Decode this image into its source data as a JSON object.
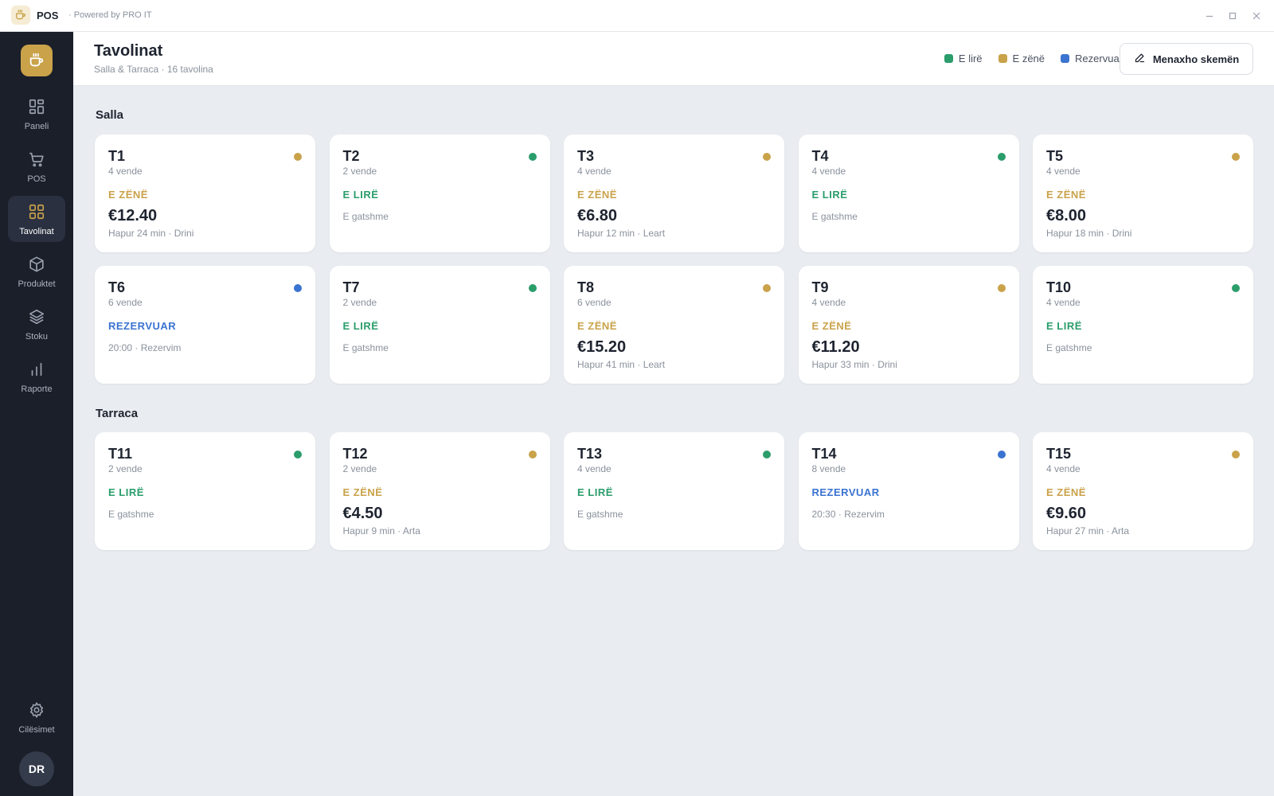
{
  "window": {
    "app_name": "POS",
    "powered_by": "· Powered by PRO IT"
  },
  "colors": {
    "accent": "#c9a24a",
    "free": "#2a9d6b",
    "occupied": "#c9a24a",
    "reserved": "#3b73d1",
    "sidebar_bg": "#1b1f2a",
    "page_bg": "#e9ecf0"
  },
  "sidebar": {
    "logo_icon": "coffee-cup-icon",
    "items": [
      {
        "label": "Paneli",
        "icon": "dashboard-icon",
        "active": false
      },
      {
        "label": "POS",
        "icon": "cart-icon",
        "active": false
      },
      {
        "label": "Tavolinat",
        "icon": "grid-icon",
        "active": true
      },
      {
        "label": "Produktet",
        "icon": "box-icon",
        "active": false
      },
      {
        "label": "Stoku",
        "icon": "layers-icon",
        "active": false
      },
      {
        "label": "Raporte",
        "icon": "bar-chart-icon",
        "active": false
      }
    ],
    "settings_label": "Cilësimet",
    "avatar_initials": "DR"
  },
  "header": {
    "title": "Tavolinat",
    "subtitle": "Salla & Tarraca · 16 tavolina",
    "legend": [
      {
        "label": "E lirë",
        "color": "#2a9d6b"
      },
      {
        "label": "E zënë",
        "color": "#c9a24a"
      },
      {
        "label": "Rezervuar",
        "color": "#3b73d1"
      }
    ],
    "edit_button_label": "Menaxho skemën"
  },
  "sections": [
    {
      "title": "Salla",
      "tables": [
        {
          "name": "T1",
          "seats": "4 vende",
          "status": "occupied",
          "status_label": "E ZËNË",
          "amount": "€12.40",
          "detail": "Hapur 24 min · Drini"
        },
        {
          "name": "T2",
          "seats": "2 vende",
          "status": "free",
          "status_label": "E LIRË",
          "amount": "",
          "detail": "E gatshme"
        },
        {
          "name": "T3",
          "seats": "4 vende",
          "status": "occupied",
          "status_label": "E ZËNË",
          "amount": "€6.80",
          "detail": "Hapur 12 min · Leart"
        },
        {
          "name": "T4",
          "seats": "4 vende",
          "status": "free",
          "status_label": "E LIRË",
          "amount": "",
          "detail": "E gatshme"
        },
        {
          "name": "T5",
          "seats": "4 vende",
          "status": "occupied",
          "status_label": "E ZËNË",
          "amount": "€8.00",
          "detail": "Hapur 18 min · Drini"
        },
        {
          "name": "T6",
          "seats": "6 vende",
          "status": "reserved",
          "status_label": "REZERVUAR",
          "amount": "",
          "detail": "20:00 · Rezervim"
        },
        {
          "name": "T7",
          "seats": "2 vende",
          "status": "free",
          "status_label": "E LIRË",
          "amount": "",
          "detail": "E gatshme"
        },
        {
          "name": "T8",
          "seats": "6 vende",
          "status": "occupied",
          "status_label": "E ZËNË",
          "amount": "€15.20",
          "detail": "Hapur 41 min · Leart"
        },
        {
          "name": "T9",
          "seats": "4 vende",
          "status": "occupied",
          "status_label": "E ZËNË",
          "amount": "€11.20",
          "detail": "Hapur 33 min · Drini"
        },
        {
          "name": "T10",
          "seats": "4 vende",
          "status": "free",
          "status_label": "E LIRË",
          "amount": "",
          "detail": "E gatshme"
        }
      ]
    },
    {
      "title": "Tarraca",
      "tables": [
        {
          "name": "T11",
          "seats": "2 vende",
          "status": "free",
          "status_label": "E LIRË",
          "amount": "",
          "detail": "E gatshme"
        },
        {
          "name": "T12",
          "seats": "2 vende",
          "status": "occupied",
          "status_label": "E ZËNË",
          "amount": "€4.50",
          "detail": "Hapur 9 min · Arta"
        },
        {
          "name": "T13",
          "seats": "4 vende",
          "status": "free",
          "status_label": "E LIRË",
          "amount": "",
          "detail": "E gatshme"
        },
        {
          "name": "T14",
          "seats": "8 vende",
          "status": "reserved",
          "status_label": "REZERVUAR",
          "amount": "",
          "detail": "20:30 · Rezervim"
        },
        {
          "name": "T15",
          "seats": "4 vende",
          "status": "occupied",
          "status_label": "E ZËNË",
          "amount": "€9.60",
          "detail": "Hapur 27 min · Arta"
        }
      ]
    }
  ]
}
